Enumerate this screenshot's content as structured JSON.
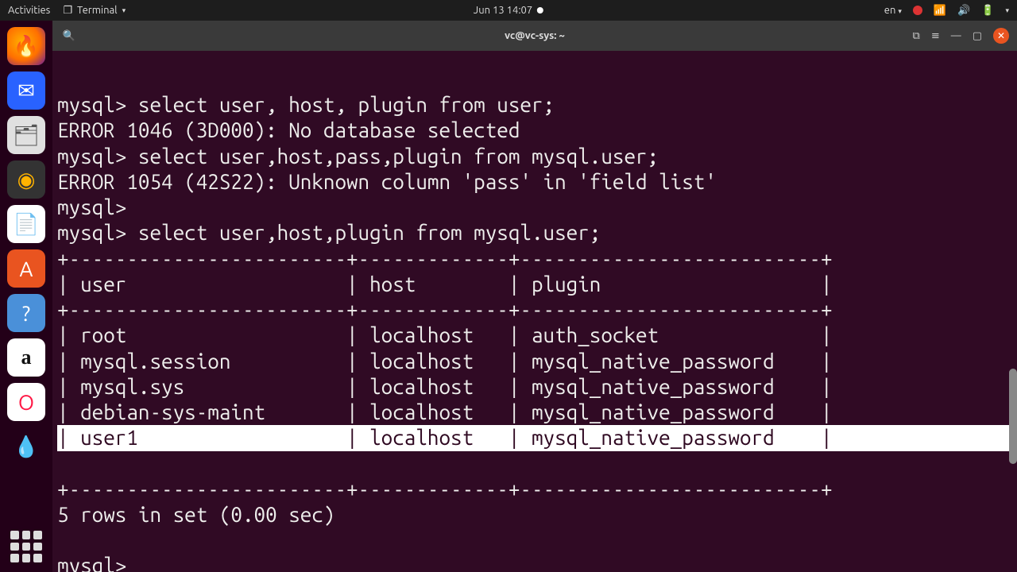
{
  "top_panel": {
    "activities": "Activities",
    "app_name": "Terminal",
    "datetime": "Jun 13  14:07",
    "lang": "en"
  },
  "dock": {
    "items": [
      "firefox",
      "thunderbird",
      "files",
      "rhythmbox",
      "writer",
      "software",
      "help",
      "amazon",
      "opera",
      "deluge"
    ]
  },
  "terminal": {
    "title": "vc@vc-sys: ~",
    "prompt": "mysql>",
    "lines": {
      "l1": "mysql> select user, host, plugin from user;",
      "l2": "ERROR 1046 (3D000): No database selected",
      "l3": "mysql> select user,host,pass,plugin from mysql.user;",
      "l4": "ERROR 1054 (42S22): Unknown column 'pass' in 'field list'",
      "l5": "mysql> ",
      "l6": "mysql> select user,host,plugin from mysql.user;",
      "sep": "+------------------------+-------------+--------------------------+",
      "hdr": "| user                   | host        | plugin                   |",
      "r1": "| root                   | localhost   | auth_socket              |",
      "r2": "| mysql.session          | localhost   | mysql_native_password    |",
      "r3": "| mysql.sys              | localhost   | mysql_native_password    |",
      "r4": "| debian-sys-maint       | localhost   | mysql_native_password    |",
      "r5": "| user1                  | localhost   | mysql_native_password    |",
      "summary": "5 rows in set (0.00 sec)",
      "blank": "",
      "last": "mysql> "
    },
    "table_data": {
      "columns": [
        "user",
        "host",
        "plugin"
      ],
      "rows": [
        {
          "user": "root",
          "host": "localhost",
          "plugin": "auth_socket"
        },
        {
          "user": "mysql.session",
          "host": "localhost",
          "plugin": "mysql_native_password"
        },
        {
          "user": "mysql.sys",
          "host": "localhost",
          "plugin": "mysql_native_password"
        },
        {
          "user": "debian-sys-maint",
          "host": "localhost",
          "plugin": "mysql_native_password"
        },
        {
          "user": "user1",
          "host": "localhost",
          "plugin": "mysql_native_password"
        }
      ],
      "row_count": 5,
      "elapsed": "0.00 sec"
    }
  }
}
